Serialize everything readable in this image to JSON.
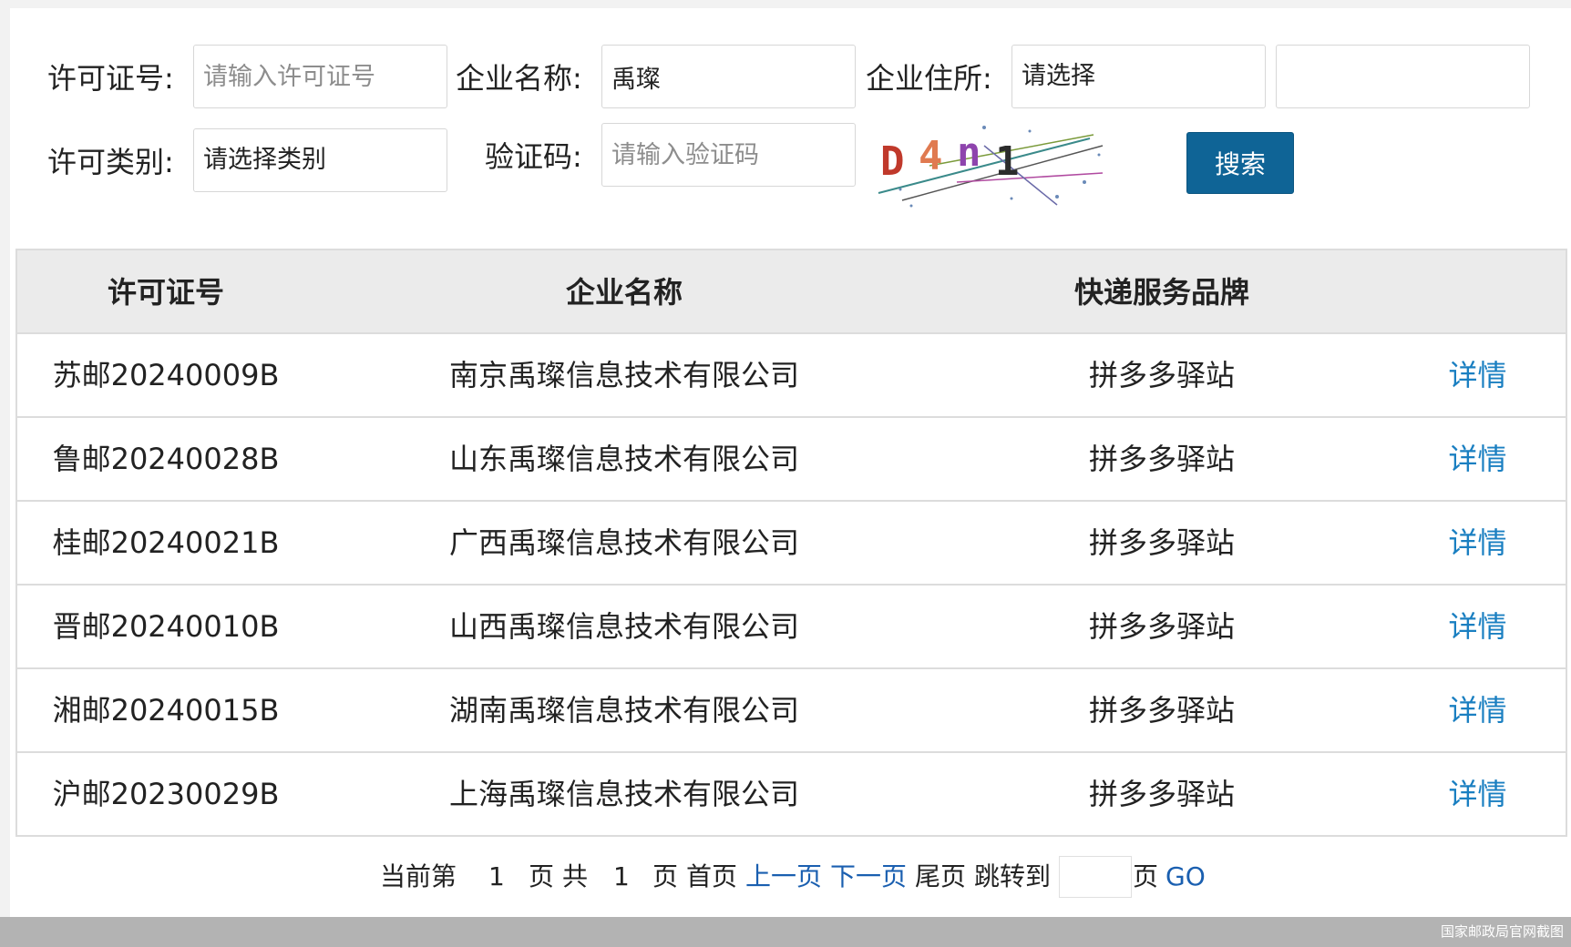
{
  "search_form": {
    "license_no": {
      "label": "许可证号:",
      "value": "",
      "placeholder": "请输入许可证号"
    },
    "company_name": {
      "label": "企业名称:",
      "value": "禹璨",
      "placeholder": ""
    },
    "company_address": {
      "label": "企业住所:",
      "selected": "请选择",
      "secondary_value": ""
    },
    "license_type": {
      "label": "许可类别:",
      "selected": "请选择类别"
    },
    "captcha": {
      "label": "验证码:",
      "value": "",
      "placeholder": "请输入验证码",
      "image_text": "D4n1"
    },
    "search_button": "搜索"
  },
  "results_table": {
    "headers": [
      "许可证号",
      "企业名称",
      "快递服务品牌",
      ""
    ],
    "rows": [
      {
        "license_no": "苏邮20240009B",
        "company": "南京禹璨信息技术有限公司",
        "brand": "拼多多驿站",
        "action": "详情"
      },
      {
        "license_no": "鲁邮20240028B",
        "company": "山东禹璨信息技术有限公司",
        "brand": "拼多多驿站",
        "action": "详情"
      },
      {
        "license_no": "桂邮20240021B",
        "company": "广西禹璨信息技术有限公司",
        "brand": "拼多多驿站",
        "action": "详情"
      },
      {
        "license_no": "晋邮20240010B",
        "company": "山西禹璨信息技术有限公司",
        "brand": "拼多多驿站",
        "action": "详情"
      },
      {
        "license_no": "湘邮20240015B",
        "company": "湖南禹璨信息技术有限公司",
        "brand": "拼多多驿站",
        "action": "详情"
      },
      {
        "license_no": "沪邮20230029B",
        "company": "上海禹璨信息技术有限公司",
        "brand": "拼多多驿站",
        "action": "详情"
      }
    ]
  },
  "pagination": {
    "current_prefix": "当前第",
    "current_page": "1",
    "page_word": "页",
    "total_prefix": "共",
    "total_pages": "1",
    "page_word_2": "页",
    "first": "首页",
    "prev": "上一页",
    "next": "下一页",
    "last": "尾页",
    "jump_to": "跳转到",
    "jump_value": "",
    "page_word_3": "页",
    "go": "GO"
  },
  "watermark": "国家邮政局官网截图",
  "colors": {
    "primary_button": "#0f6496",
    "link": "#1a7fc1",
    "header_bg": "#ebebeb"
  }
}
